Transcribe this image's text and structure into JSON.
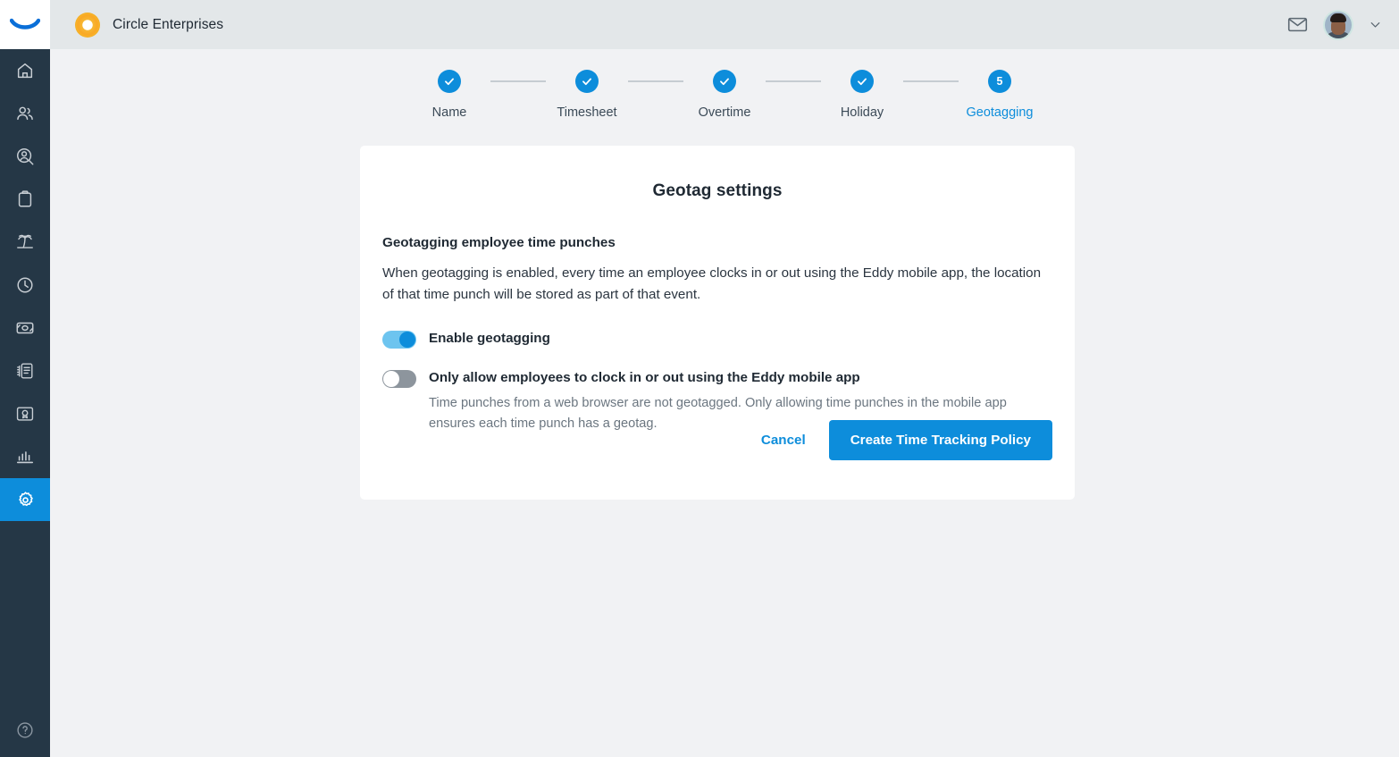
{
  "brand": {
    "product_logo": "eddy-smile-logo",
    "accent_color": "#0d8ddb",
    "sidebar_color": "#253746",
    "org_logo_color": "#f5a623"
  },
  "sidebar": {
    "items": [
      {
        "icon": "home-icon",
        "name": "sidebar-item-home",
        "active": false
      },
      {
        "icon": "people-icon",
        "name": "sidebar-item-people",
        "active": false
      },
      {
        "icon": "person-search-icon",
        "name": "sidebar-item-recruiting",
        "active": false
      },
      {
        "icon": "clipboard-icon",
        "name": "sidebar-item-onboarding",
        "active": false
      },
      {
        "icon": "palm-tree-icon",
        "name": "sidebar-item-time-off",
        "active": false
      },
      {
        "icon": "clock-icon",
        "name": "sidebar-item-time-tracking",
        "active": false
      },
      {
        "icon": "money-icon",
        "name": "sidebar-item-payroll",
        "active": false
      },
      {
        "icon": "documents-icon",
        "name": "sidebar-item-documents",
        "active": false
      },
      {
        "icon": "certificate-icon",
        "name": "sidebar-item-training",
        "active": false
      },
      {
        "icon": "bar-chart-icon",
        "name": "sidebar-item-reports",
        "active": false
      },
      {
        "icon": "gear-icon",
        "name": "sidebar-item-settings",
        "active": true
      }
    ],
    "help": {
      "icon": "help-circle-icon",
      "name": "help-button"
    }
  },
  "topbar": {
    "org_name": "Circle Enterprises",
    "mail_icon": "envelope-icon",
    "avatar": "user-avatar",
    "caret_icon": "chevron-down-icon"
  },
  "stepper": {
    "steps": [
      {
        "label": "Name",
        "state": "complete",
        "marker": "check"
      },
      {
        "label": "Timesheet",
        "state": "complete",
        "marker": "check"
      },
      {
        "label": "Overtime",
        "state": "complete",
        "marker": "check"
      },
      {
        "label": "Holiday",
        "state": "complete",
        "marker": "check"
      },
      {
        "label": "Geotagging",
        "state": "current",
        "marker": "5"
      }
    ]
  },
  "card": {
    "title": "Geotag settings",
    "section_heading": "Geotagging employee time punches",
    "section_body": "When geotagging is enabled, every time an employee clocks in or out using the Eddy mobile app, the location of that time punch will be stored as part of that event.",
    "toggles": [
      {
        "label": "Enable geotagging",
        "state": "on",
        "description": ""
      },
      {
        "label": "Only allow employees to clock in or out using the Eddy mobile app",
        "state": "off",
        "description": "Time punches from a web browser are not geotagged. Only allowing time punches in the mobile app ensures each time punch has a geotag."
      }
    ],
    "cancel_label": "Cancel",
    "submit_label": "Create Time Tracking Policy"
  }
}
